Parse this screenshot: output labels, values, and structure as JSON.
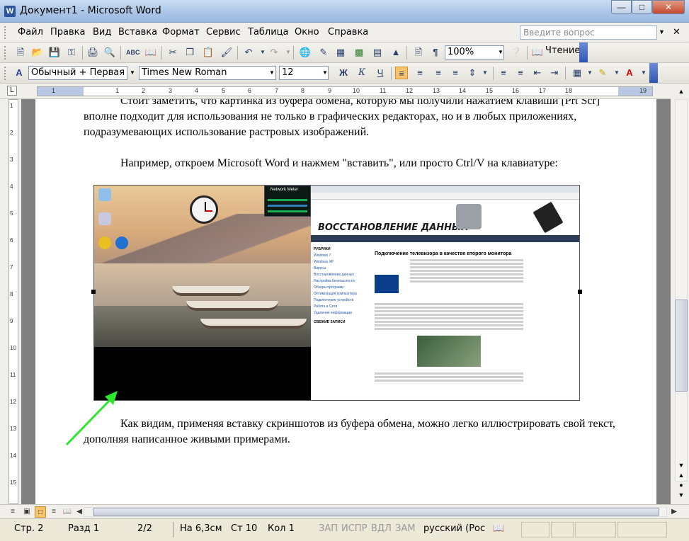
{
  "window": {
    "title": "Документ1 - Microsoft Word",
    "app_icon": "W"
  },
  "menu": {
    "items": [
      "Файл",
      "Правка",
      "Вид",
      "Вставка",
      "Формат",
      "Сервис",
      "Таблица",
      "Окно",
      "Справка"
    ],
    "help_placeholder": "Введите вопрос"
  },
  "toolbar_standard": {
    "zoom": "100%",
    "read_label": "Чтение"
  },
  "toolbar_format": {
    "style": "Обычный + Первая ст",
    "font": "Times New Roman",
    "size": "12",
    "bold_label": "Ж",
    "italic_label": "К",
    "underline_label": "Ч"
  },
  "ruler": {
    "ticks": [
      "1",
      "1",
      "2",
      "3",
      "4",
      "5",
      "6",
      "7",
      "8",
      "9",
      "10",
      "11",
      "12",
      "13",
      "14",
      "15",
      "16",
      "17",
      "18",
      "19"
    ]
  },
  "vruler": {
    "ticks": [
      "1",
      "2",
      "3",
      "4",
      "5",
      "6",
      "7",
      "8",
      "9",
      "10",
      "11",
      "12",
      "13",
      "14",
      "15"
    ]
  },
  "document": {
    "para1": "Стоит заметить, что картинка из буфера обмена, которую мы получили нажатием клавиши [Prt Scr] вполне подходит для использования не только в графических редакторах, но и в любых приложениях, подразумевающих использование растровых изображений.",
    "para2": "Например, откроем Microsoft Word и нажмем \"вставить\", или просто Ctrl/V на клавиатуре:",
    "para3": "Как видим, применяя вставку скриншотов из буфера обмена, можно легко иллюстрировать свой текст, дополняя написанное живыми примерами."
  },
  "screenshot": {
    "gadget_title": "Network Meter",
    "site_title": "ВОССТАНОВЛЕНИЕ ДАННЫХ",
    "article_title": "Подключение телевизора в качестве второго монитора",
    "rubric_header": "РУБРИКИ",
    "rubrics": [
      "Windows 7",
      "Windows XP",
      "Вирусы",
      "Восстановление данных",
      "Настройка безопасности",
      "Обзоры программ",
      "Оптимизация компьютера",
      "Подключение устройств",
      "Работа в Сети",
      "Удаление информации"
    ],
    "recent_header": "СВЕЖИЕ ЗАПИСИ"
  },
  "colors": {
    "arrow": "#2ee62e",
    "accent": "#2f55b4"
  },
  "statusbar": {
    "page": "Стр. 2",
    "section": "Разд 1",
    "pages": "2/2",
    "position": "На 6,3см",
    "line": "Ст 10",
    "column": "Кол 1",
    "rec": "ЗАП",
    "trk": "ИСПР",
    "ext": "ВДЛ",
    "ovr": "ЗАМ",
    "language": "русский (Рос"
  }
}
